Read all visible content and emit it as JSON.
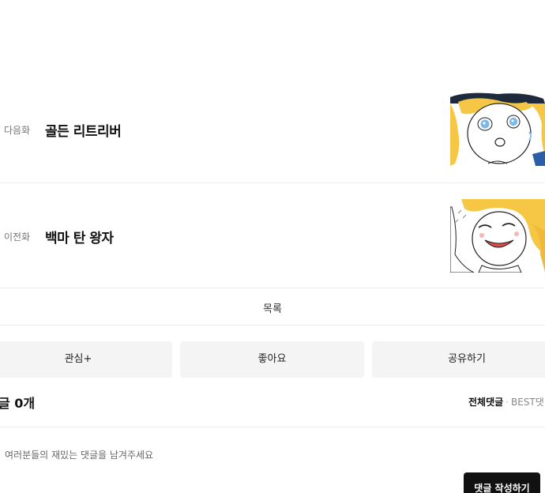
{
  "next_episode": {
    "label": "다음화",
    "title": "골든 리트리버"
  },
  "prev_episode": {
    "label": "이전화",
    "title": "백마 탄 왕자"
  },
  "list_label": "목록",
  "actions": {
    "interest": "관심+",
    "like": "좋아요",
    "share": "공유하기"
  },
  "comments": {
    "count_label": "글 0개",
    "sort_all": "전체댓글",
    "sort_best": "BEST댓",
    "placeholder": "여러분들의 재밌는 댓글을 남겨주세요",
    "write_button": "댓글 작성하기"
  },
  "colors": {
    "button_bg": "#f4f4f4",
    "write_button_bg": "#111111",
    "divider": "#ececec"
  }
}
